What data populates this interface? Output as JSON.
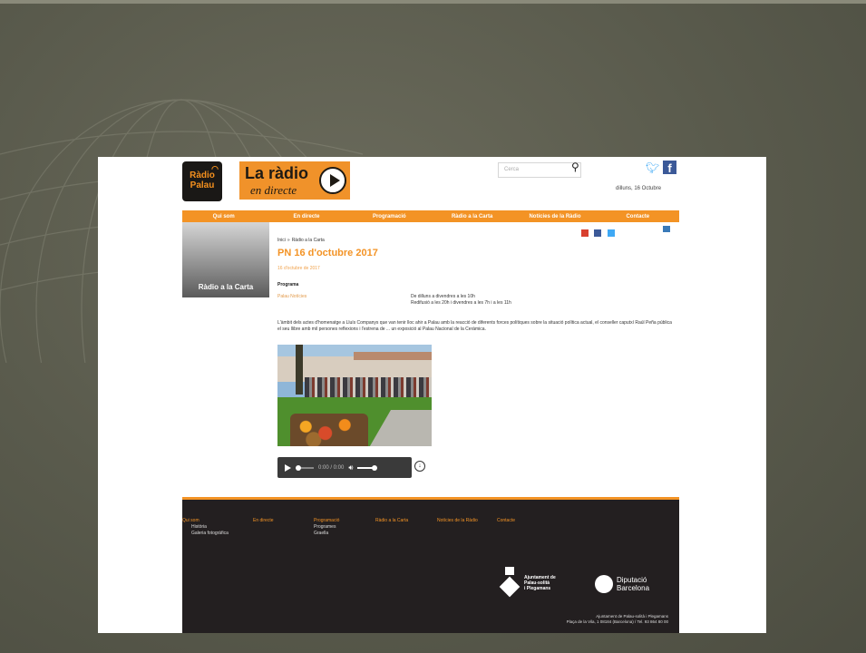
{
  "brand": {
    "logo_line1": "Ràdio",
    "logo_line2": "Palau"
  },
  "live_banner": {
    "title": "La ràdio",
    "subtitle": "en directe"
  },
  "search": {
    "placeholder": "Cerca"
  },
  "header": {
    "date": "dilluns, 16 Octubre"
  },
  "nav": {
    "items": [
      "Qui som",
      "En directe",
      "Programació",
      "Ràdio a la Carta",
      "Notícies de la Ràdio",
      "Contacte"
    ]
  },
  "sidebar": {
    "title": "Ràdio a la Carta"
  },
  "breadcrumb": {
    "home": "Inici",
    "current": "Ràdio a la Carta"
  },
  "article": {
    "title": "PN 16 d'octubre 2017",
    "date": "16 d'octubre de 2017",
    "programa_label": "Programa",
    "programa_link": "Palau Notícies",
    "schedule_line1": "De dilluns a divendres a les 10h",
    "schedule_line2": "Redifusió a les 20h i divendres a les 7h i a les 11h",
    "description": "L'àmbit dels actes d'homenatge a Lluís Companys que van tenir lloc ahir a Palau amb la reacció de diferents forces polítiques sobre la situació política actual, el conseller caputxí Raúl Peña pública el seu llibre amb mil persones reflexions i l'estrena de ... un exposició al Palau Nacional de la Ceràmica."
  },
  "player": {
    "time": "0:00 / 0:00"
  },
  "footer": {
    "columns": [
      {
        "head": "Qui som",
        "items": [
          "Història",
          "Galeria fotogràfica"
        ]
      },
      {
        "head": "En directe",
        "items": []
      },
      {
        "head": "Programació",
        "items": [
          "Programes",
          "Graella"
        ]
      },
      {
        "head": "Ràdio a la Carta",
        "items": []
      },
      {
        "head": "Notícies de la Ràdio",
        "items": []
      },
      {
        "head": "Contacte",
        "items": []
      }
    ],
    "council_line1": "Ajuntament de",
    "council_line2": "Palau-solità",
    "council_line3": "i Plegamans",
    "dipu_line1": "Diputació",
    "dipu_line2": "Barcelona",
    "address_line1": "Ajuntament de Palau-solità i Plegamans",
    "address_line2": "Plaça de la Vila, 1 08184 (Barcelona) / Tel. 93 864 80 00"
  },
  "colors": {
    "accent": "#f39325",
    "footer_bg": "#231f20",
    "backdrop": "#595a4c"
  }
}
